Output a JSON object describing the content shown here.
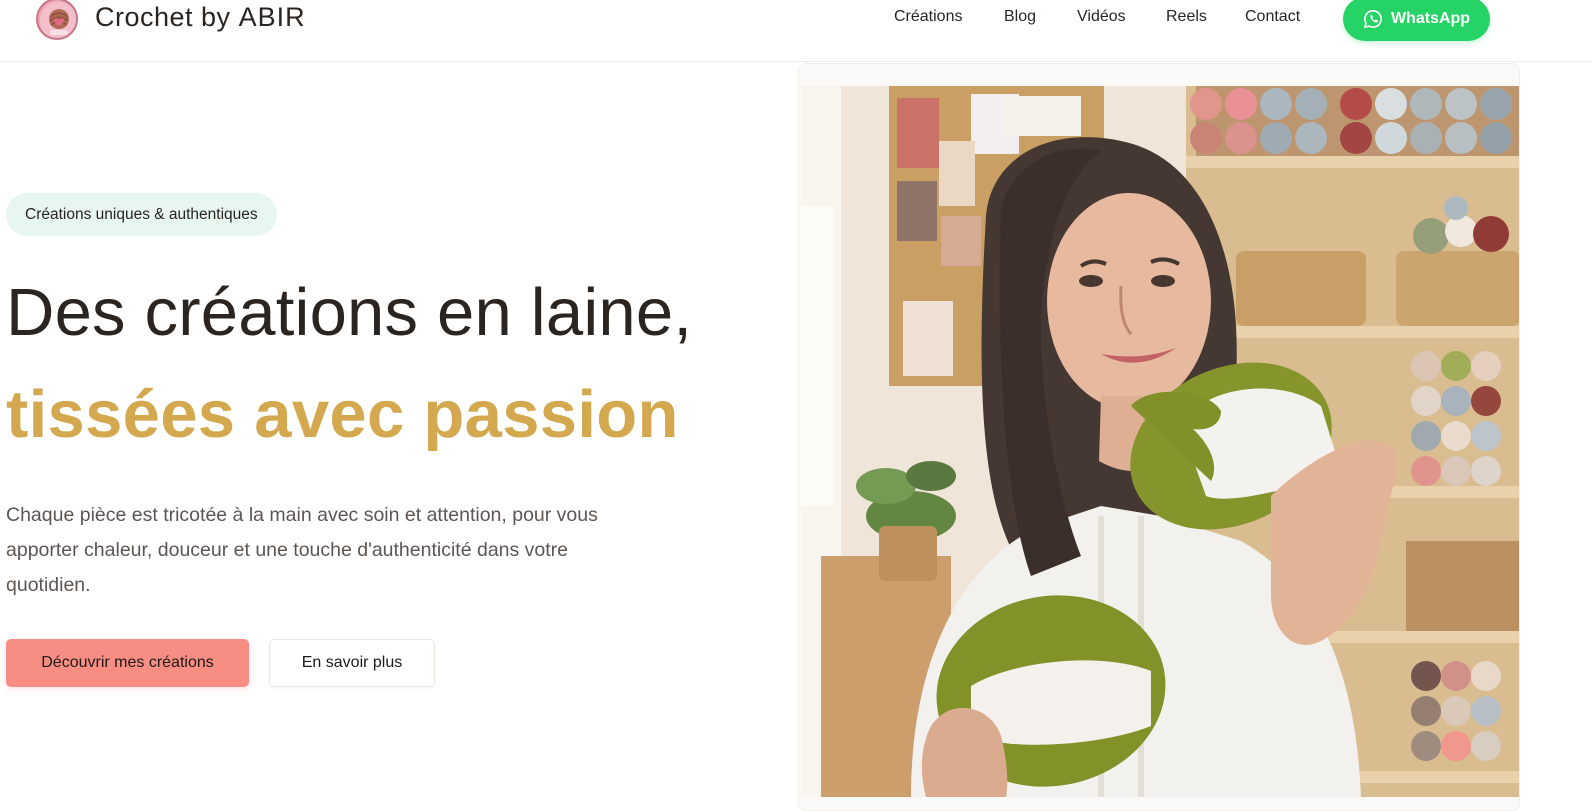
{
  "header": {
    "logo_icon": "yarn-heart-logo",
    "brand_prefix": "Crochet by",
    "brand_name": "ABIR",
    "nav": {
      "creations": "Créations",
      "blog": "Blog",
      "videos": "Vidéos",
      "reels": "Reels",
      "contact": "Contact"
    },
    "whatsapp": {
      "label": "WhatsApp",
      "icon": "whatsapp-icon",
      "color": "#25d366"
    }
  },
  "hero": {
    "badge": "Créations uniques & authentiques",
    "headline_line1": "Des créations en laine,",
    "headline_line2": "tissées avec passion",
    "description": "Chaque pièce est tricotée à la main avec soin et attention, pour vous apporter chaleur, douceur et une touche d'authenticité dans votre quotidien.",
    "primary_button": "Découvrir mes créations",
    "secondary_button": "En savoir plus",
    "photo": "woman-holding-green-yarn-photo"
  },
  "colors": {
    "accent_gold": "#d4a84e",
    "primary_coral": "#f88d84",
    "badge_mint": "#e7f6ee",
    "text_dark": "#2b2521"
  }
}
